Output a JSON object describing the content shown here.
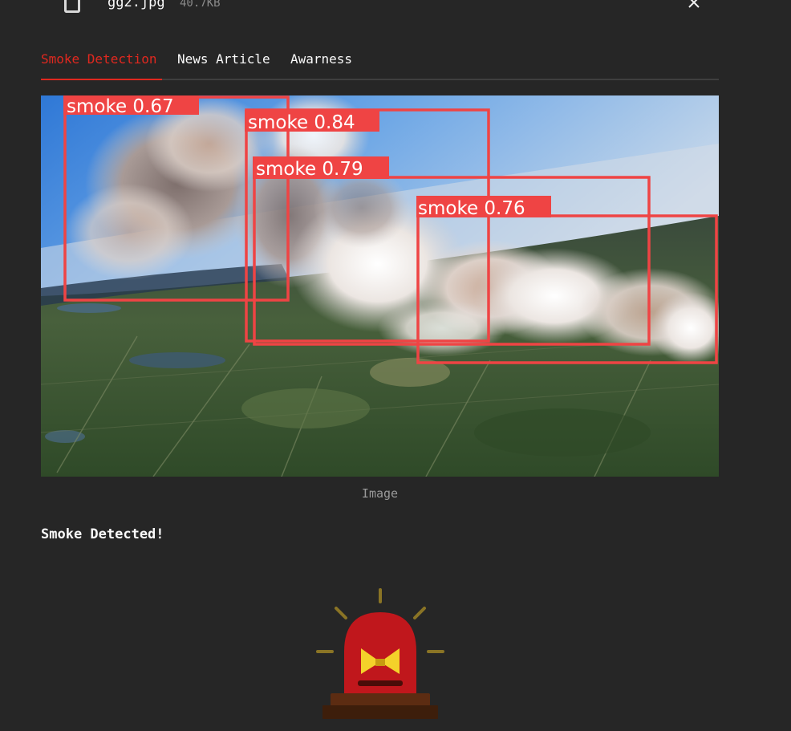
{
  "file": {
    "name": "gg2.jpg",
    "size": "40.7KB",
    "icon": "file-icon",
    "close_icon": "close-icon"
  },
  "tabs": [
    {
      "label": "Smoke Detection",
      "active": true
    },
    {
      "label": "News Article",
      "active": false
    },
    {
      "label": "Awarness",
      "active": false
    }
  ],
  "image": {
    "caption": "Image",
    "detections": [
      {
        "label": "smoke 0.67"
      },
      {
        "label": "smoke 0.84"
      },
      {
        "label": "smoke 0.79"
      },
      {
        "label": "smoke 0.76"
      }
    ]
  },
  "result": {
    "title": "Smoke Detected!",
    "icon": "siren-icon"
  },
  "colors": {
    "background": "#262626",
    "accent": "#e0281f",
    "box": "#ef4444",
    "siren_red": "#c0171c",
    "siren_yellow": "#f4d22a"
  }
}
